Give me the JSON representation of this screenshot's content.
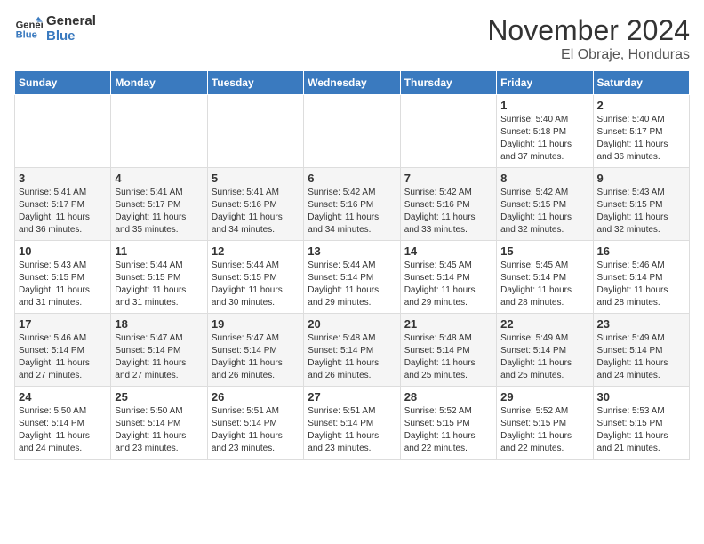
{
  "logo": {
    "line1": "General",
    "line2": "Blue"
  },
  "title": "November 2024",
  "location": "El Obraje, Honduras",
  "weekdays": [
    "Sunday",
    "Monday",
    "Tuesday",
    "Wednesday",
    "Thursday",
    "Friday",
    "Saturday"
  ],
  "weeks": [
    [
      {
        "day": "",
        "info": ""
      },
      {
        "day": "",
        "info": ""
      },
      {
        "day": "",
        "info": ""
      },
      {
        "day": "",
        "info": ""
      },
      {
        "day": "",
        "info": ""
      },
      {
        "day": "1",
        "info": "Sunrise: 5:40 AM\nSunset: 5:18 PM\nDaylight: 11 hours\nand 37 minutes."
      },
      {
        "day": "2",
        "info": "Sunrise: 5:40 AM\nSunset: 5:17 PM\nDaylight: 11 hours\nand 36 minutes."
      }
    ],
    [
      {
        "day": "3",
        "info": "Sunrise: 5:41 AM\nSunset: 5:17 PM\nDaylight: 11 hours\nand 36 minutes."
      },
      {
        "day": "4",
        "info": "Sunrise: 5:41 AM\nSunset: 5:17 PM\nDaylight: 11 hours\nand 35 minutes."
      },
      {
        "day": "5",
        "info": "Sunrise: 5:41 AM\nSunset: 5:16 PM\nDaylight: 11 hours\nand 34 minutes."
      },
      {
        "day": "6",
        "info": "Sunrise: 5:42 AM\nSunset: 5:16 PM\nDaylight: 11 hours\nand 34 minutes."
      },
      {
        "day": "7",
        "info": "Sunrise: 5:42 AM\nSunset: 5:16 PM\nDaylight: 11 hours\nand 33 minutes."
      },
      {
        "day": "8",
        "info": "Sunrise: 5:42 AM\nSunset: 5:15 PM\nDaylight: 11 hours\nand 32 minutes."
      },
      {
        "day": "9",
        "info": "Sunrise: 5:43 AM\nSunset: 5:15 PM\nDaylight: 11 hours\nand 32 minutes."
      }
    ],
    [
      {
        "day": "10",
        "info": "Sunrise: 5:43 AM\nSunset: 5:15 PM\nDaylight: 11 hours\nand 31 minutes."
      },
      {
        "day": "11",
        "info": "Sunrise: 5:44 AM\nSunset: 5:15 PM\nDaylight: 11 hours\nand 31 minutes."
      },
      {
        "day": "12",
        "info": "Sunrise: 5:44 AM\nSunset: 5:15 PM\nDaylight: 11 hours\nand 30 minutes."
      },
      {
        "day": "13",
        "info": "Sunrise: 5:44 AM\nSunset: 5:14 PM\nDaylight: 11 hours\nand 29 minutes."
      },
      {
        "day": "14",
        "info": "Sunrise: 5:45 AM\nSunset: 5:14 PM\nDaylight: 11 hours\nand 29 minutes."
      },
      {
        "day": "15",
        "info": "Sunrise: 5:45 AM\nSunset: 5:14 PM\nDaylight: 11 hours\nand 28 minutes."
      },
      {
        "day": "16",
        "info": "Sunrise: 5:46 AM\nSunset: 5:14 PM\nDaylight: 11 hours\nand 28 minutes."
      }
    ],
    [
      {
        "day": "17",
        "info": "Sunrise: 5:46 AM\nSunset: 5:14 PM\nDaylight: 11 hours\nand 27 minutes."
      },
      {
        "day": "18",
        "info": "Sunrise: 5:47 AM\nSunset: 5:14 PM\nDaylight: 11 hours\nand 27 minutes."
      },
      {
        "day": "19",
        "info": "Sunrise: 5:47 AM\nSunset: 5:14 PM\nDaylight: 11 hours\nand 26 minutes."
      },
      {
        "day": "20",
        "info": "Sunrise: 5:48 AM\nSunset: 5:14 PM\nDaylight: 11 hours\nand 26 minutes."
      },
      {
        "day": "21",
        "info": "Sunrise: 5:48 AM\nSunset: 5:14 PM\nDaylight: 11 hours\nand 25 minutes."
      },
      {
        "day": "22",
        "info": "Sunrise: 5:49 AM\nSunset: 5:14 PM\nDaylight: 11 hours\nand 25 minutes."
      },
      {
        "day": "23",
        "info": "Sunrise: 5:49 AM\nSunset: 5:14 PM\nDaylight: 11 hours\nand 24 minutes."
      }
    ],
    [
      {
        "day": "24",
        "info": "Sunrise: 5:50 AM\nSunset: 5:14 PM\nDaylight: 11 hours\nand 24 minutes."
      },
      {
        "day": "25",
        "info": "Sunrise: 5:50 AM\nSunset: 5:14 PM\nDaylight: 11 hours\nand 23 minutes."
      },
      {
        "day": "26",
        "info": "Sunrise: 5:51 AM\nSunset: 5:14 PM\nDaylight: 11 hours\nand 23 minutes."
      },
      {
        "day": "27",
        "info": "Sunrise: 5:51 AM\nSunset: 5:14 PM\nDaylight: 11 hours\nand 23 minutes."
      },
      {
        "day": "28",
        "info": "Sunrise: 5:52 AM\nSunset: 5:15 PM\nDaylight: 11 hours\nand 22 minutes."
      },
      {
        "day": "29",
        "info": "Sunrise: 5:52 AM\nSunset: 5:15 PM\nDaylight: 11 hours\nand 22 minutes."
      },
      {
        "day": "30",
        "info": "Sunrise: 5:53 AM\nSunset: 5:15 PM\nDaylight: 11 hours\nand 21 minutes."
      }
    ]
  ]
}
